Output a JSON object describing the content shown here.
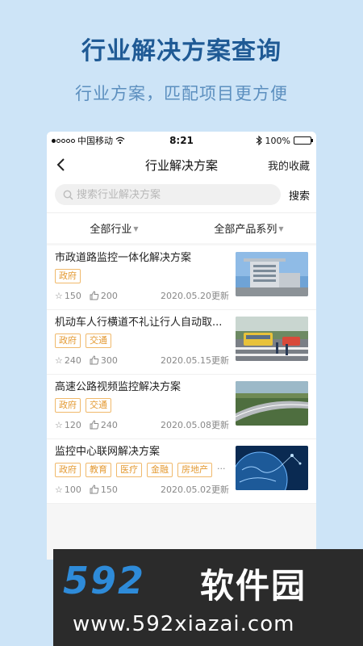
{
  "promo": {
    "title": "行业解决方案查询",
    "subtitle": "行业方案，匹配项目更方便"
  },
  "statusbar": {
    "carrier": "中国移动",
    "time": "8:21",
    "battery": "100%"
  },
  "navbar": {
    "title": "行业解决方案",
    "favorites_label": "我的收藏"
  },
  "search": {
    "placeholder": "搜索行业解决方案",
    "button_label": "搜索"
  },
  "filters": {
    "industry": "全部行业",
    "product_series": "全部产品系列"
  },
  "solutions": [
    {
      "title": "市政道路监控一体化解决方案",
      "tags": [
        "政府"
      ],
      "favorites": "150",
      "likes": "200",
      "updated": "2020.05.20更新",
      "image": "government-building-photo"
    },
    {
      "title": "机动车人行横道不礼让行人自动取...",
      "tags": [
        "政府",
        "交通"
      ],
      "favorites": "240",
      "likes": "300",
      "updated": "2020.05.15更新",
      "image": "crosswalk-traffic-photo"
    },
    {
      "title": "高速公路视频监控解决方案",
      "tags": [
        "政府",
        "交通"
      ],
      "favorites": "120",
      "likes": "240",
      "updated": "2020.05.08更新",
      "image": "highway-photo"
    },
    {
      "title": "监控中心联网解决方案",
      "tags": [
        "政府",
        "教育",
        "医疗",
        "金融",
        "房地产"
      ],
      "more": "···",
      "favorites": "100",
      "likes": "150",
      "updated": "2020.05.02更新",
      "image": "globe-network-photo"
    }
  ],
  "watermark": {
    "logo": "592",
    "brand": "软件园",
    "url": "www.592xiazai.com"
  },
  "colors": {
    "background": "#cde4f7",
    "title": "#1f5a95",
    "tag": "#e49a33"
  }
}
